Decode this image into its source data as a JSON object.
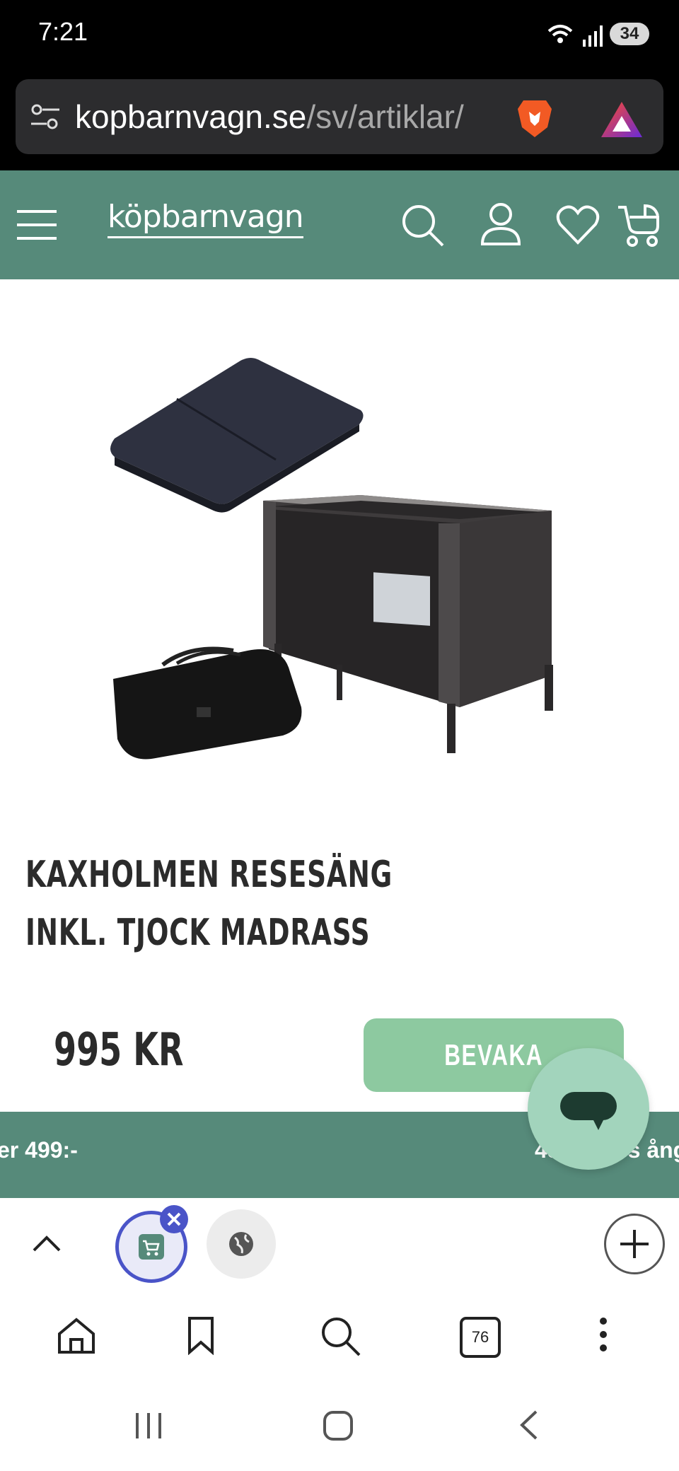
{
  "status_bar": {
    "time": "7:21",
    "battery": "34",
    "network": "5"
  },
  "browser": {
    "url_host": "kopbarnvagn.se",
    "url_path": "/sv/artiklar/",
    "tab_count": "76"
  },
  "site": {
    "logo": "köpbarnvagn",
    "brand_color": "#568a7a"
  },
  "product": {
    "title": "KAXHOLMEN RESESÄNG INKL. TJOCK MADRASS",
    "price": "995 KR",
    "watch_button": "BEVAKA"
  },
  "promo": {
    "left_text": "er 499:-",
    "right_text": "45 dagars ång"
  },
  "colors": {
    "accent": "#568a7a",
    "button": "#8dc9a0",
    "chat": "#a2d4bc"
  }
}
